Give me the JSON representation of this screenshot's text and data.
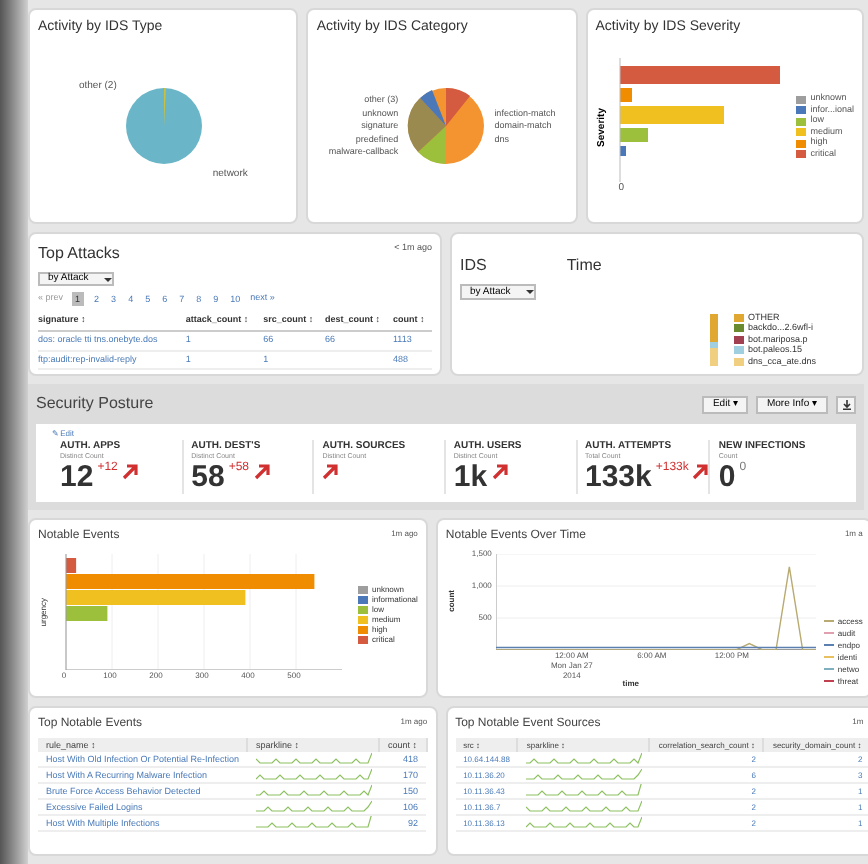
{
  "ids_type": {
    "title": "Activity by IDS Type",
    "labels": [
      "other (2)",
      "network"
    ]
  },
  "ids_category": {
    "title": "Activity by IDS Category",
    "labels_left": [
      "other (3)",
      "unknown",
      "signature",
      "predefined",
      "malware-callback"
    ],
    "labels_right": [
      "infection-match",
      "domain-match",
      "dns"
    ]
  },
  "ids_severity": {
    "title": "Activity by IDS Severity",
    "ylabel": "Severity",
    "xtick": "0",
    "legend": [
      {
        "label": "unknown",
        "color": "#9e9e9e"
      },
      {
        "label": "infor...ional",
        "color": "#4a78b8"
      },
      {
        "label": "low",
        "color": "#9cc03c"
      },
      {
        "label": "medium",
        "color": "#f0c020"
      },
      {
        "label": "high",
        "color": "#f08c00"
      },
      {
        "label": "critical",
        "color": "#d45a40"
      }
    ]
  },
  "top_attacks": {
    "title": "Top Attacks",
    "age": "< 1m ago",
    "dropdown": "by Attack",
    "prev": "« prev",
    "next": "next »",
    "pages": [
      {
        "label": "1",
        "selected": true
      },
      {
        "label": "2",
        "selected": false
      },
      {
        "label": "3",
        "selected": false
      },
      {
        "label": "4",
        "selected": false
      },
      {
        "label": "5",
        "selected": false
      },
      {
        "label": "6",
        "selected": false
      },
      {
        "label": "7",
        "selected": false
      },
      {
        "label": "8",
        "selected": false
      },
      {
        "label": "9",
        "selected": false
      },
      {
        "label": "10",
        "selected": false
      }
    ],
    "columns": [
      "signature ↕",
      "attack_count ↕",
      "src_count ↕",
      "dest_count ↕",
      "count ↕"
    ],
    "rows": [
      [
        "dos: oracle tti tns.onebyte.dos",
        "1",
        "66",
        "66",
        "1113"
      ],
      [
        "ftp:audit:rep-invalid-reply",
        "1",
        "1",
        null,
        "488"
      ]
    ]
  },
  "ids_time": {
    "title_start": "IDS",
    "title_end": "Time",
    "dropdown": "by Attack",
    "legend": [
      {
        "label": "OTHER",
        "color": "#e0a830"
      },
      {
        "label": "backdo...2.6wfl-i",
        "color": "#6a8a30"
      },
      {
        "label": "bot.mariposa.p",
        "color": "#a04050"
      },
      {
        "label": "bot.paleos.15",
        "color": "#a0d0e0"
      },
      {
        "label": "dns_cca_ate.dns",
        "color": "#f0d080"
      }
    ]
  },
  "security_posture": {
    "title": "Security Posture",
    "buttons": [
      "Edit ▾",
      "More Info ▾"
    ],
    "edit_link": "✎ Edit",
    "kpis": [
      {
        "label": "AUTH. APPS",
        "sublabel": "Distinct Count",
        "value": "12",
        "delta": "+12",
        "rising": true
      },
      {
        "label": "AUTH. DEST'S",
        "sublabel": "Distinct Count",
        "value": "58",
        "delta": "+58",
        "rising": true
      },
      {
        "label": "AUTH. SOURCES",
        "sublabel": "Distinct Count",
        "rising": true
      },
      {
        "label": "AUTH. USERS",
        "sublabel": "Distinct Count",
        "value": "1k",
        "rising": true
      },
      {
        "label": "AUTH. ATTEMPTS",
        "sublabel": "Total Count",
        "value": "133k",
        "delta": "+133k",
        "rising": true
      },
      {
        "label": "NEW INFECTIONS",
        "sublabel": "Count",
        "value": "0",
        "delta": "0",
        "rising": false
      }
    ]
  },
  "notable_events": {
    "title": "Notable Events",
    "age": "1m ago",
    "chart_data": {
      "type": "bar",
      "orientation": "horizontal",
      "stacked": false,
      "grid": true,
      "ylabel": "urgency",
      "xlim": [
        0,
        600
      ],
      "xticks": [
        0,
        100,
        200,
        300,
        400,
        500
      ],
      "series": [
        {
          "name": "unknown",
          "color": "#9e9e9e",
          "values": [
            0
          ]
        },
        {
          "name": "informational",
          "color": "#4a78b8",
          "values": [
            0
          ]
        },
        {
          "name": "low",
          "color": "#9cc03c",
          "values": [
            90
          ]
        },
        {
          "name": "medium",
          "color": "#f0c020",
          "values": [
            390
          ]
        },
        {
          "name": "high",
          "color": "#f08c00",
          "values": [
            540
          ]
        },
        {
          "name": "critical",
          "color": "#d45a40",
          "values": [
            22
          ]
        }
      ]
    }
  },
  "notable_time": {
    "title": "Notable Events Over Time",
    "age": "1m a",
    "legend": [
      {
        "kind": "series"
      },
      {
        "kind": "label",
        "label": "audit",
        "color": "#e0a0b0"
      },
      {
        "kind": "series"
      },
      {
        "kind": "label",
        "label": "identi",
        "color": "#e8c060"
      },
      {
        "kind": "label",
        "label": "netwo",
        "color": "#7fb0c0"
      },
      {
        "kind": "label",
        "label": "threat",
        "color": "#c04050"
      }
    ],
    "chart_data": {
      "type": "line",
      "grid": true,
      "xlabel": "time",
      "ylabel": "count",
      "x": [
        -6,
        -5,
        -4,
        -3,
        -2,
        -1,
        0,
        1,
        2,
        3,
        4,
        5,
        6,
        7,
        8,
        9,
        10,
        11,
        12,
        13,
        14,
        15,
        16,
        17,
        18
      ],
      "xlim": [
        -6,
        18
      ],
      "ylim": [
        0,
        1500
      ],
      "yticks": [
        {
          "value": 500,
          "label": "500"
        },
        {
          "value": 1000,
          "label": "1,000"
        },
        {
          "value": 1500,
          "label": "1,500"
        }
      ],
      "xticks": [
        {
          "value": 0,
          "label": "12:00 AM Mon Jan 27 2014"
        },
        {
          "value": 6,
          "label": "6:00 AM"
        },
        {
          "value": 12,
          "label": "12:00 PM"
        }
      ],
      "series": [
        {
          "name": "access",
          "color": "#b8aa70",
          "values": [
            0,
            0,
            0,
            0,
            0,
            0,
            0,
            0,
            0,
            0,
            0,
            0,
            0,
            0,
            0,
            0,
            0,
            0,
            0,
            100,
            0,
            0,
            1300,
            0,
            0
          ]
        },
        {
          "name": "endpo",
          "color": "#5a7fb0",
          "values": [
            40,
            40,
            40,
            40,
            40,
            40,
            40,
            40,
            40,
            40,
            40,
            40,
            40,
            40,
            40,
            40,
            40,
            40,
            40,
            40,
            40,
            40,
            40,
            40,
            40
          ]
        }
      ]
    }
  },
  "top_notable_events": {
    "title": "Top Notable Events",
    "age": "1m ago",
    "columns": [
      "rule_name ↕",
      "sparkline ↕",
      "count ↕"
    ],
    "rows": [
      {
        "name": "Host With Old Infection Or Potential Re-Infection",
        "count": "418"
      },
      {
        "name": "Host With A Recurring Malware Infection",
        "count": "170"
      },
      {
        "name": "Brute Force Access Behavior Detected",
        "count": "150"
      },
      {
        "name": "Excessive Failed Logins",
        "count": "106"
      },
      {
        "name": "Host With Multiple Infections",
        "count": "92"
      }
    ]
  },
  "top_sources": {
    "title": "Top Notable Event Sources",
    "age": "1m",
    "columns": [
      "src ↕",
      "sparkline ↕",
      "correlation_search_count ↕",
      "security_domain_count ↕"
    ],
    "rows": [
      {
        "src": "10.64.144.88",
        "correlation": "2",
        "domain": "2"
      },
      {
        "src": "10.11.36.20",
        "correlation": "6",
        "domain": "3"
      },
      {
        "src": "10.11.36.43",
        "correlation": "2",
        "domain": "1"
      },
      {
        "src": "10.11.36.7",
        "correlation": "2",
        "domain": "1"
      },
      {
        "src": "10.11.36.13",
        "correlation": "2",
        "domain": "1"
      }
    ]
  }
}
